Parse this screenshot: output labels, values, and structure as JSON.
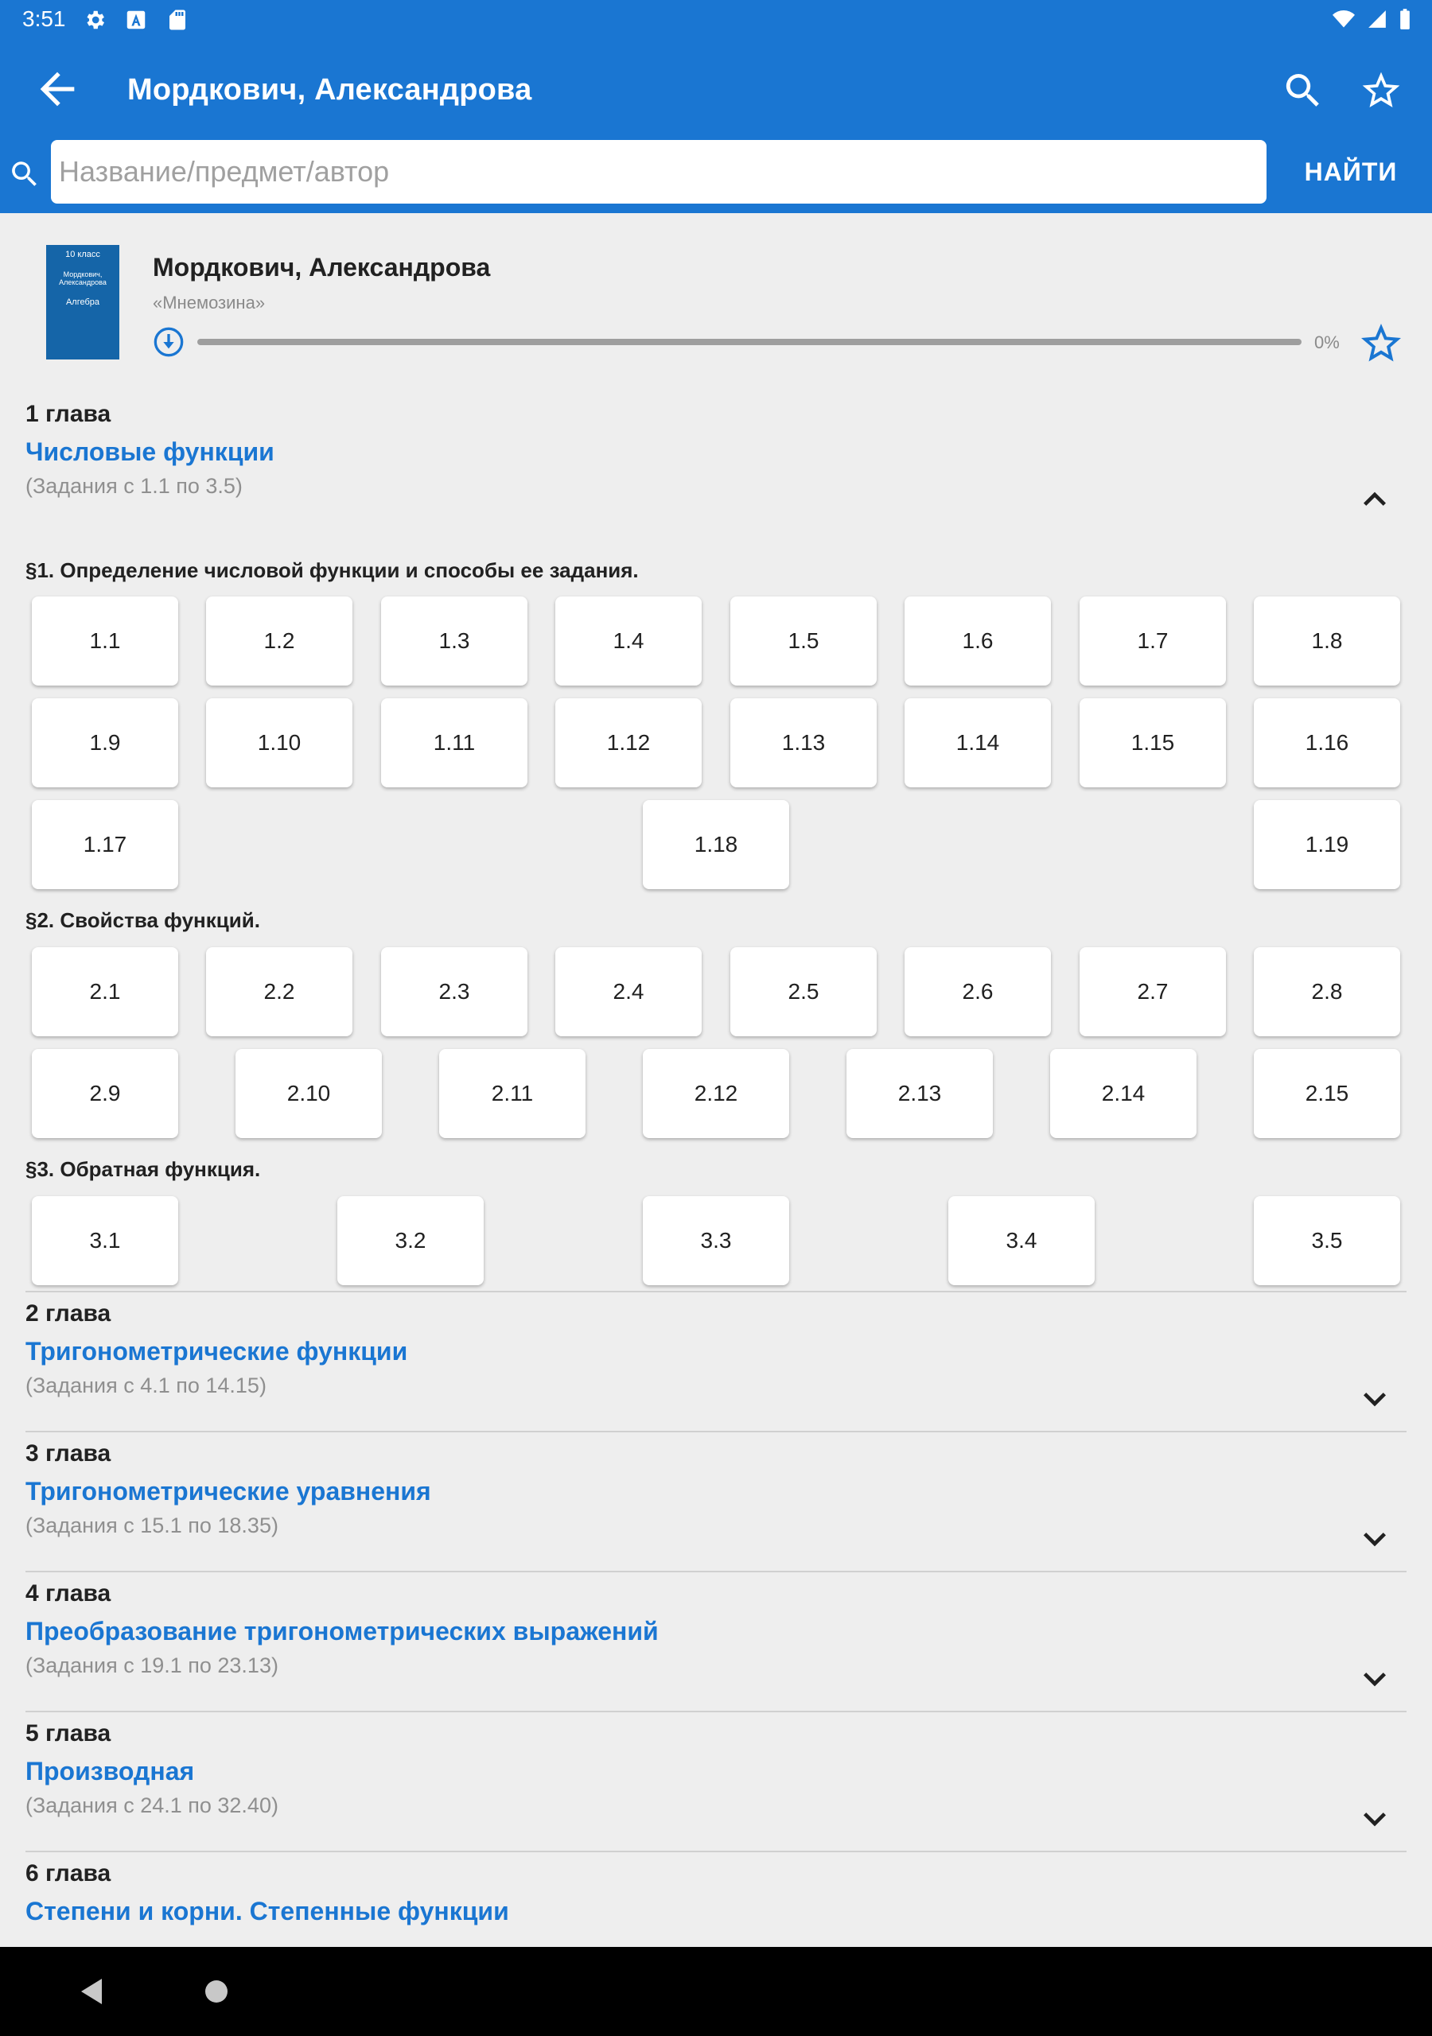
{
  "status_bar": {
    "time": "3:51"
  },
  "app_bar": {
    "title": "Мордкович, Александрова"
  },
  "search": {
    "placeholder": "Название/предмет/автор",
    "button_label": "НАЙТИ"
  },
  "book": {
    "cover": {
      "grade": "10 класс",
      "authors": "Мордкович, Александрова",
      "subject": "Алгебра"
    },
    "title": "Мордкович, Александрова",
    "publisher": "«Мнемозина»",
    "download_progress": 0,
    "download_progress_label": "0%"
  },
  "chapters": [
    {
      "number": "1 глава",
      "title": "Числовые функции",
      "range": "(Задания с 1.1 по 3.5)",
      "expanded": true,
      "sections": [
        {
          "title": "§1. Определение числовой функции и способы ее задания.",
          "tasks": [
            "1.1",
            "1.2",
            "1.3",
            "1.4",
            "1.5",
            "1.6",
            "1.7",
            "1.8",
            "1.9",
            "1.10",
            "1.11",
            "1.12",
            "1.13",
            "1.14",
            "1.15",
            "1.16",
            "1.17",
            "1.18",
            "1.19"
          ]
        },
        {
          "title": "§2. Свойства функций.",
          "tasks": [
            "2.1",
            "2.2",
            "2.3",
            "2.4",
            "2.5",
            "2.6",
            "2.7",
            "2.8",
            "2.9",
            "2.10",
            "2.11",
            "2.12",
            "2.13",
            "2.14",
            "2.15"
          ]
        },
        {
          "title": "§3. Обратная функция.",
          "tasks": [
            "3.1",
            "3.2",
            "3.3",
            "3.4",
            "3.5"
          ]
        }
      ]
    },
    {
      "number": "2 глава",
      "title": "Тригонометрические функции",
      "range": "(Задания с 4.1 по 14.15)",
      "expanded": false
    },
    {
      "number": "3 глава",
      "title": "Тригонометрические уравнения",
      "range": "(Задания с 15.1 по 18.35)",
      "expanded": false
    },
    {
      "number": "4 глава",
      "title": "Преобразование тригонометрических выражений",
      "range": "(Задания с 19.1 по 23.13)",
      "expanded": false
    },
    {
      "number": "5 глава",
      "title": "Производная",
      "range": "(Задания с 24.1 по 32.40)",
      "expanded": false
    },
    {
      "number": "6 глава",
      "title": "Степени и корни. Степенные функции",
      "expanded": false
    }
  ],
  "colors": {
    "primary": "#1a76d2",
    "background": "#eeeeee",
    "tile": "#ffffff",
    "secondary_text": "#8f8f8f"
  },
  "icons": {
    "status": [
      "settings-icon",
      "text-a-icon",
      "sd-card-icon",
      "wifi-icon",
      "signal-icon",
      "battery-icon"
    ],
    "app_bar": [
      "back-arrow-icon",
      "search-icon",
      "star-outline-icon"
    ],
    "book": [
      "download-icon",
      "star-outline-icon"
    ],
    "chapter_toggle": [
      "chevron-up-icon",
      "chevron-down-icon"
    ],
    "navigation": [
      "nav-back-icon",
      "nav-home-icon"
    ]
  }
}
